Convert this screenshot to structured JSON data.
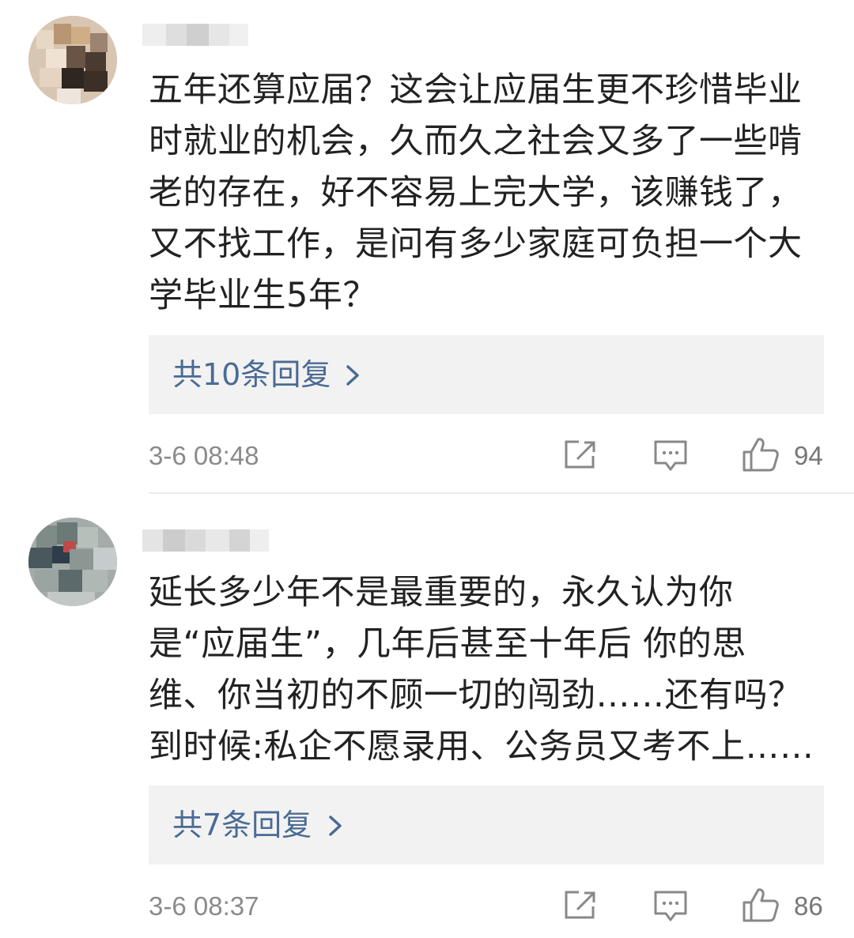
{
  "comments": [
    {
      "text": "五年还算应届？这会让应届生更不珍惜毕业\n时就业的机会，久而久之社会又多了一些啃\n老的存在，好不容易上完大学，该赚钱了，\n又不找工作，是问有多少家庭可负担一个大\n学毕业生5年？",
      "reply_label": "共10条回复",
      "timestamp": "3-6 08:48",
      "likes": "94",
      "avatar_icon": "pixelated-avatar",
      "username_icon": "pixelated-username"
    },
    {
      "text": "延长多少年不是最重要的，永久认为你\n是“应届生”，几年后甚至十年后 你的思\n维、你当初的不顾一切的闯劲……还有吗？\n到时候:私企不愿录用、公务员又考不上……",
      "reply_label": "共7条回复",
      "timestamp": "3-6 08:37",
      "likes": "86",
      "avatar_icon": "pixelated-avatar",
      "username_icon": "pixelated-username"
    }
  ],
  "icons": {
    "share": "share-icon",
    "comment": "comment-icon",
    "like": "thumbs-up-icon",
    "chevron": "chevron-right-icon"
  },
  "colors": {
    "link": "#4a6b94",
    "reply_background": "#f2f2f2",
    "meta_text": "#8a8a8a",
    "icon_stroke": "#888888"
  }
}
